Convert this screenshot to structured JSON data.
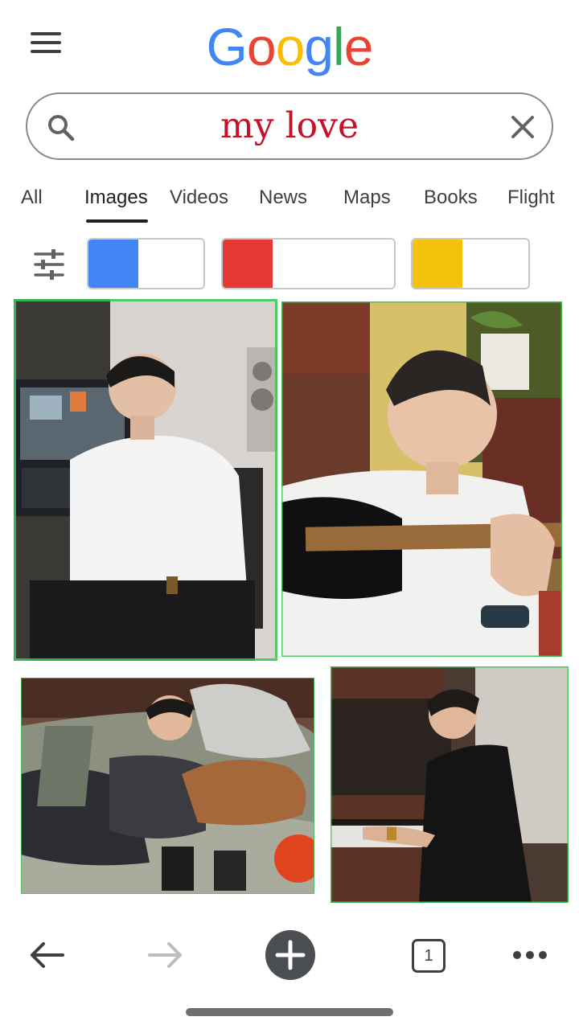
{
  "header": {
    "logo_letters": [
      {
        "ch": "G",
        "color": "#4285F4"
      },
      {
        "ch": "o",
        "color": "#EA4335"
      },
      {
        "ch": "o",
        "color": "#FBBC05"
      },
      {
        "ch": "g",
        "color": "#4285F4"
      },
      {
        "ch": "l",
        "color": "#34A853"
      },
      {
        "ch": "e",
        "color": "#EA4335"
      }
    ],
    "menu_icon": "hamburger-menu-icon"
  },
  "search": {
    "query": "my love",
    "query_color": "#C4122A",
    "search_icon": "search-icon",
    "clear_icon": "close-icon"
  },
  "tabs": [
    {
      "label": "All",
      "active": false
    },
    {
      "label": "Images",
      "active": true
    },
    {
      "label": "Videos",
      "active": false
    },
    {
      "label": "News",
      "active": false
    },
    {
      "label": "Maps",
      "active": false
    },
    {
      "label": "Books",
      "active": false
    },
    {
      "label": "Flight",
      "active": false
    }
  ],
  "filters": {
    "tune_icon": "tune-icon",
    "color_chips": [
      {
        "color": "#4285F4"
      },
      {
        "color": "#E53935"
      },
      {
        "color": "#F4C20D"
      }
    ]
  },
  "results": [
    {
      "name": "studio-desk-photo",
      "accent": "#37C957"
    },
    {
      "name": "guitar-photo",
      "accent": "#37C957"
    },
    {
      "name": "sofa-dog-photo",
      "accent": "#37C957"
    },
    {
      "name": "piano-photo",
      "accent": "#37C957"
    }
  ],
  "bottom_nav": {
    "back_icon": "back-arrow-icon",
    "forward_icon": "forward-arrow-icon",
    "new_tab_icon": "plus-icon",
    "tab_count": "1",
    "more_icon": "more-dots-icon"
  }
}
